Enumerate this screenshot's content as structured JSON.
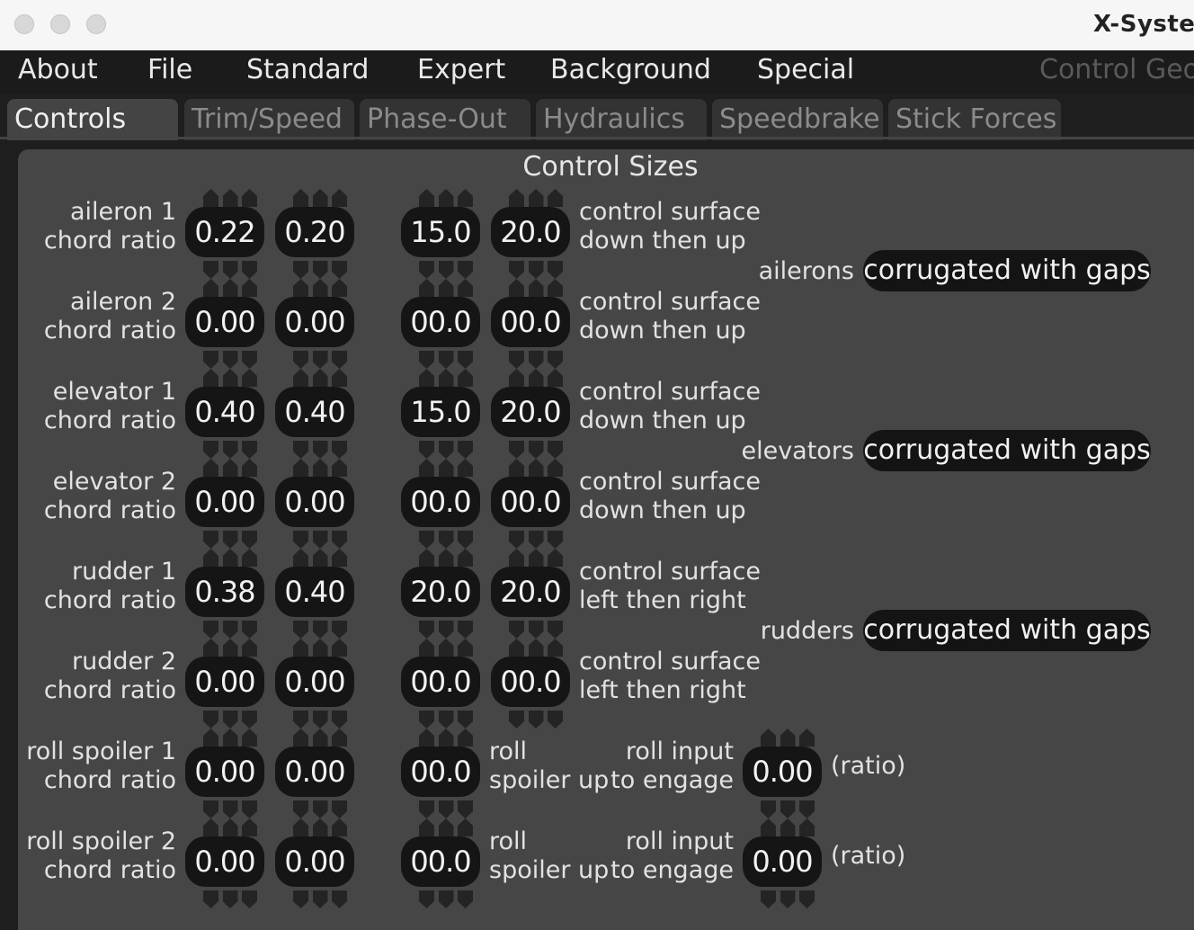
{
  "window": {
    "title": "X-Syster"
  },
  "menu": {
    "items": [
      "About",
      "File",
      "Standard",
      "Expert",
      "Background",
      "Special"
    ],
    "right_label": "Control Geor"
  },
  "tabs": [
    "Controls",
    "Trim/Speed",
    "Phase-Out",
    "Hydraulics",
    "Speedbrake",
    "Stick Forces"
  ],
  "panel": {
    "title": "Control Sizes",
    "rows": [
      {
        "name": "aileron 1",
        "sub": "chord ratio",
        "v1": "0.22",
        "v2": "0.20",
        "v3": "15.0",
        "v4": "20.0",
        "desc1": "control surface",
        "desc2": "down then up"
      },
      {
        "name": "aileron 2",
        "sub": "chord ratio",
        "v1": "0.00",
        "v2": "0.00",
        "v3": "00.0",
        "v4": "00.0",
        "desc1": "control surface",
        "desc2": "down then up"
      },
      {
        "name": "elevator 1",
        "sub": "chord ratio",
        "v1": "0.40",
        "v2": "0.40",
        "v3": "15.0",
        "v4": "20.0",
        "desc1": "control surface",
        "desc2": "down then up"
      },
      {
        "name": "elevator 2",
        "sub": "chord ratio",
        "v1": "0.00",
        "v2": "0.00",
        "v3": "00.0",
        "v4": "00.0",
        "desc1": "control surface",
        "desc2": "down then up"
      },
      {
        "name": "rudder 1",
        "sub": "chord ratio",
        "v1": "0.38",
        "v2": "0.40",
        "v3": "20.0",
        "v4": "20.0",
        "desc1": "control surface",
        "desc2": "left then right"
      },
      {
        "name": "rudder 2",
        "sub": "chord ratio",
        "v1": "0.00",
        "v2": "0.00",
        "v3": "00.0",
        "v4": "00.0",
        "desc1": "control surface",
        "desc2": "left then right"
      }
    ],
    "spoilers": [
      {
        "name": "roll spoiler 1",
        "sub": "chord ratio",
        "v1": "0.00",
        "v2": "0.00",
        "v3": "00.0",
        "desc1": "roll",
        "desc2": "spoiler up",
        "eng1": "roll input",
        "eng2": "to engage",
        "engage_value": "0.00",
        "unit": "(ratio)"
      },
      {
        "name": "roll spoiler 2",
        "sub": "chord ratio",
        "v1": "0.00",
        "v2": "0.00",
        "v3": "00.0",
        "desc1": "roll",
        "desc2": "spoiler up",
        "eng1": "roll input",
        "eng2": "to engage",
        "engage_value": "0.00",
        "unit": "(ratio)"
      }
    ],
    "surface_types": [
      {
        "label": "ailerons",
        "value": "corrugated with gaps"
      },
      {
        "label": "elevators",
        "value": "corrugated with gaps"
      },
      {
        "label": "rudders",
        "value": "corrugated with gaps"
      }
    ]
  }
}
